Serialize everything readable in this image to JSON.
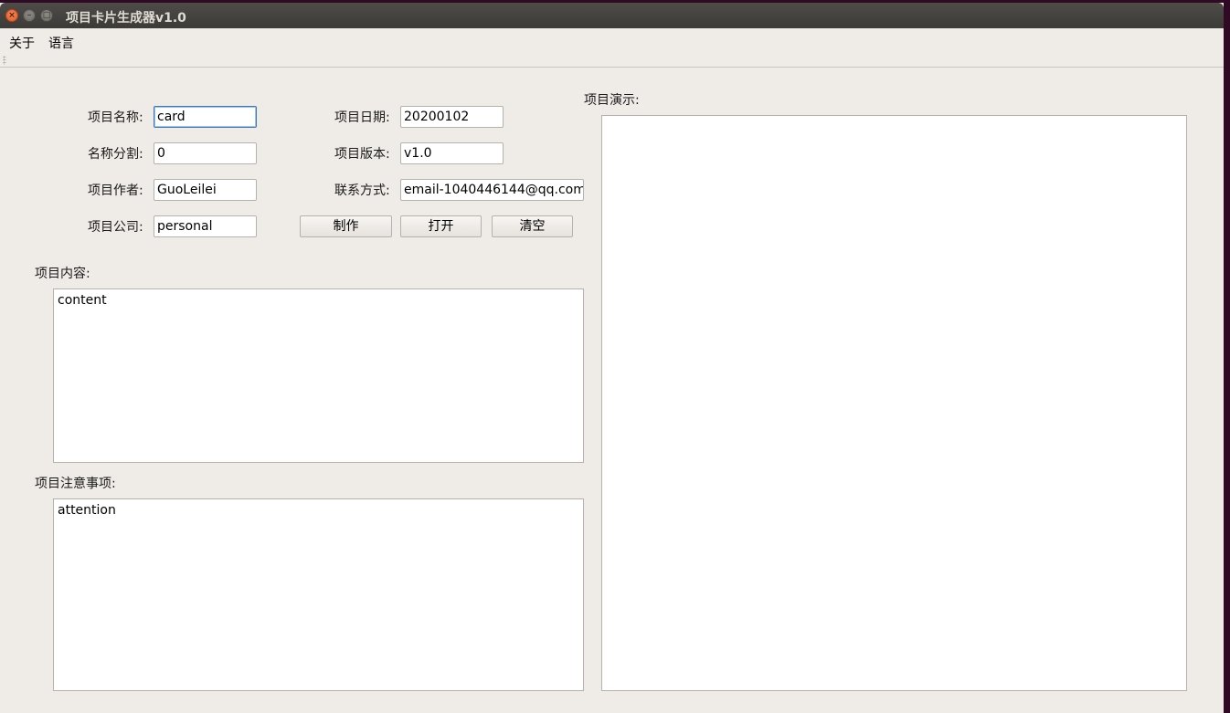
{
  "window": {
    "title": "项目卡片生成器v1.0",
    "close_glyph": "×",
    "min_glyph": "–",
    "max_glyph": "□"
  },
  "menu": {
    "about": "关于",
    "language": "语言"
  },
  "form": {
    "name_label": "项目名称:",
    "name_value": "card",
    "split_label": "名称分割:",
    "split_value": "0",
    "author_label": "项目作者:",
    "author_value": "GuoLeilei",
    "company_label": "项目公司:",
    "company_value": "personal",
    "date_label": "项目日期:",
    "date_value": "20200102",
    "version_label": "项目版本:",
    "version_value": "v1.0",
    "contact_label": "联系方式:",
    "contact_value": "email-1040446144@qq.com"
  },
  "buttons": {
    "make": "制作",
    "open": "打开",
    "clear": "清空"
  },
  "content": {
    "label": "项目内容:",
    "value": "content"
  },
  "attention": {
    "label": "项目注意事项:",
    "value": "attention"
  },
  "preview": {
    "label": "项目演示:"
  }
}
